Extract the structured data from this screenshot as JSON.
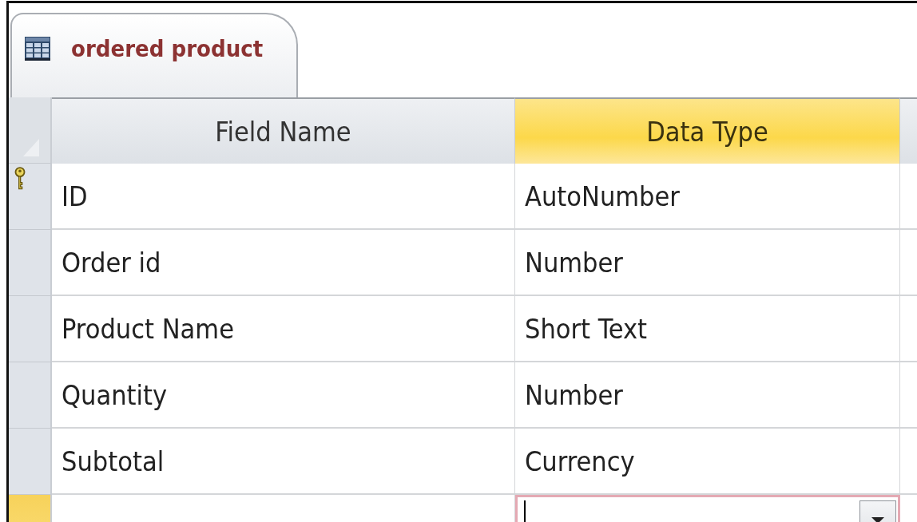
{
  "tab": {
    "label": "ordered product",
    "selected": true
  },
  "columns": [
    {
      "label": "Field Name",
      "selected": false
    },
    {
      "label": "Data Type",
      "selected": true
    }
  ],
  "rows": [
    {
      "field_name": "ID",
      "data_type": "AutoNumber",
      "primary_key": true,
      "selected": false
    },
    {
      "field_name": "Order id",
      "data_type": "Number",
      "primary_key": false,
      "selected": false
    },
    {
      "field_name": "Product Name",
      "data_type": "Short Text",
      "primary_key": false,
      "selected": false
    },
    {
      "field_name": "Quantity",
      "data_type": "Number",
      "primary_key": false,
      "selected": false
    },
    {
      "field_name": "Subtotal",
      "data_type": "Currency",
      "primary_key": false,
      "selected": false
    }
  ],
  "new_row": {
    "selected": true
  }
}
